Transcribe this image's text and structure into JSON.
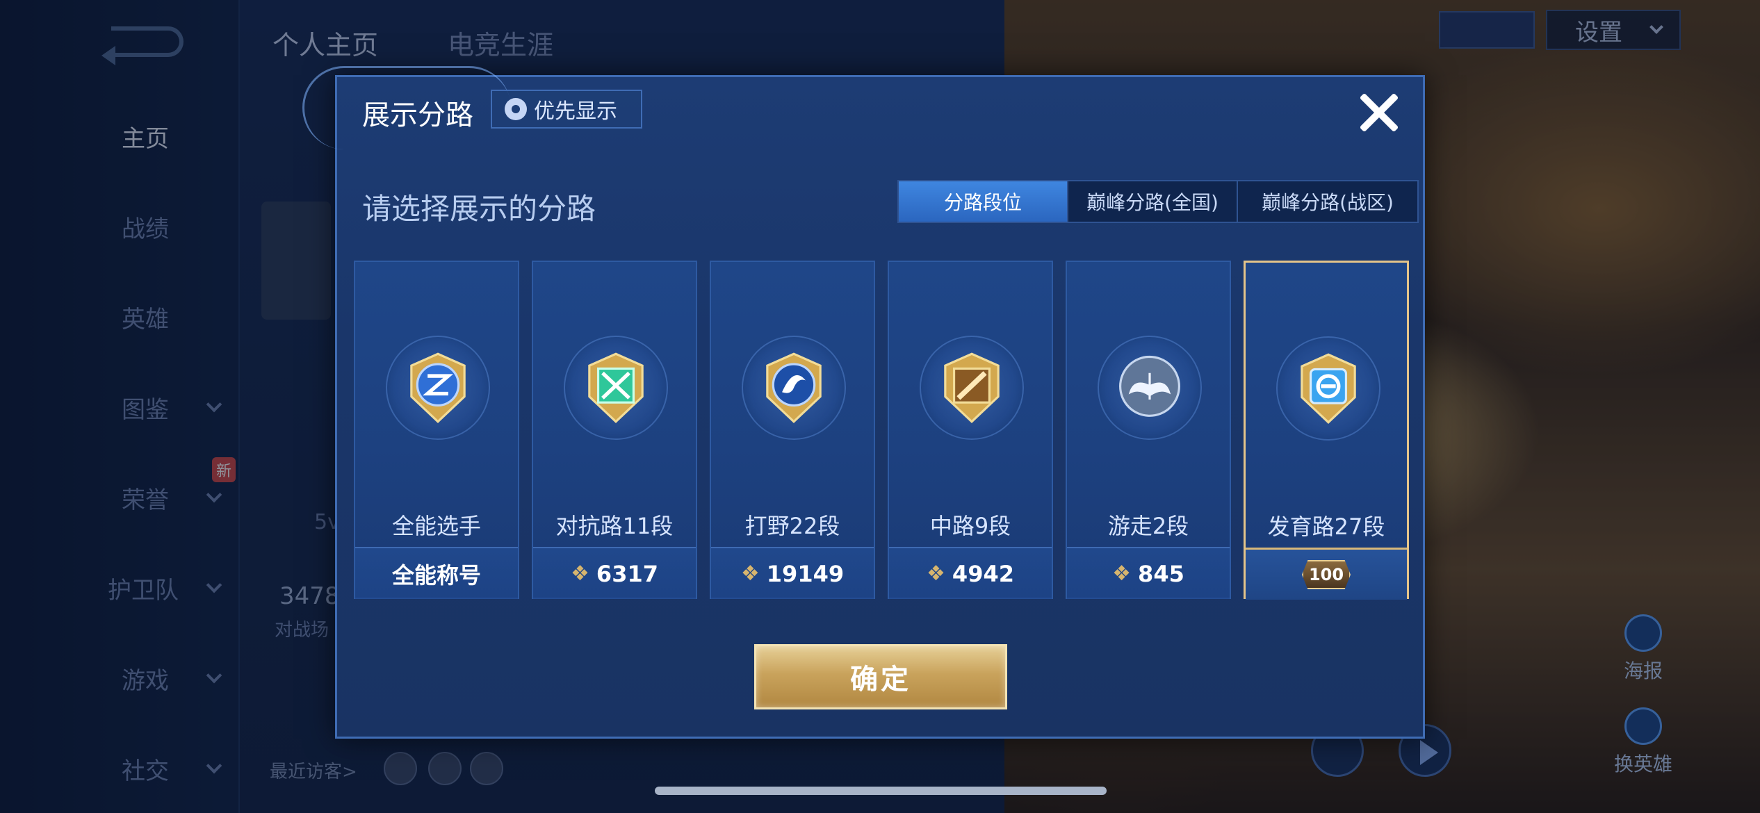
{
  "background": {
    "nav": {
      "items": [
        {
          "label": "主页",
          "active": true,
          "chevron": false
        },
        {
          "label": "战绩",
          "active": false,
          "chevron": false
        },
        {
          "label": "英雄",
          "active": false,
          "chevron": false
        },
        {
          "label": "图鉴",
          "active": false,
          "chevron": true
        },
        {
          "label": "荣誉",
          "active": false,
          "chevron": true
        },
        {
          "label": "护卫队",
          "active": false,
          "chevron": true
        },
        {
          "label": "游戏",
          "active": false,
          "chevron": true
        },
        {
          "label": "社交",
          "active": false,
          "chevron": true
        }
      ],
      "new_badge": "新"
    },
    "top_tabs": [
      "个人主页",
      "电竞生涯"
    ],
    "settings_label": "设置",
    "stat_number": "3478",
    "stat_label": "对战场",
    "val_5v": "5v",
    "recent_visitors": "最近访客>",
    "side_actions": {
      "poster": "海报",
      "change_hero": "换英雄"
    }
  },
  "modal": {
    "title": "展示分路",
    "priority_button": "优先显示",
    "prompt": "请选择展示的分路",
    "segment_tabs": [
      "分路段位",
      "巅峰分路(全国)",
      "巅峰分路(战区)"
    ],
    "active_segment": 0,
    "cards": [
      {
        "name": "全能选手",
        "footer": "全能称号",
        "has_points": false,
        "accent": "#3b7be8"
      },
      {
        "name": "对抗路11段",
        "footer": "6317",
        "has_points": true,
        "accent": "#2fc79a"
      },
      {
        "name": "打野22段",
        "footer": "19149",
        "has_points": true,
        "accent": "#2f6fd6"
      },
      {
        "name": "中路9段",
        "footer": "4942",
        "has_points": true,
        "accent": "#c7893a"
      },
      {
        "name": "游走2段",
        "footer": "845",
        "has_points": true,
        "accent": "#8ea6c6"
      },
      {
        "name": "发育路27段",
        "footer": "100",
        "has_points": false,
        "selected": true,
        "accent": "#3aa4f0"
      }
    ],
    "confirm_button": "确定"
  },
  "colors": {
    "modal_bg": "#1d3c74",
    "gold": "#c9a35c",
    "active_tab": "#3f86e0"
  }
}
